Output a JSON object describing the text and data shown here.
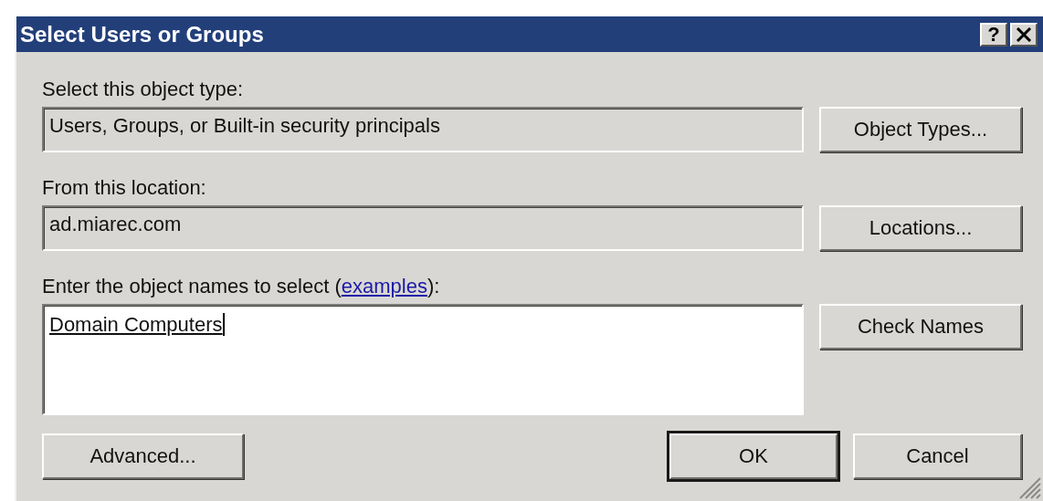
{
  "window": {
    "title": "Select Users or Groups",
    "help_label": "?"
  },
  "object_type": {
    "label": "Select this object type:",
    "value": "Users, Groups, or Built-in security principals",
    "button": "Object Types..."
  },
  "location": {
    "label": "From this location:",
    "value": "ad.miarec.com",
    "button": "Locations..."
  },
  "names": {
    "label_before": "Enter the object names to select (",
    "link": "examples",
    "label_after": "):",
    "value": "Domain Computers",
    "resolved": true,
    "button": "Check Names"
  },
  "buttons": [
    {
      "label": "Advanced...",
      "default": false,
      "kind": "left"
    },
    {
      "label": "OK",
      "default": true,
      "kind": "right"
    },
    {
      "label": "Cancel",
      "default": false,
      "kind": "right"
    }
  ]
}
